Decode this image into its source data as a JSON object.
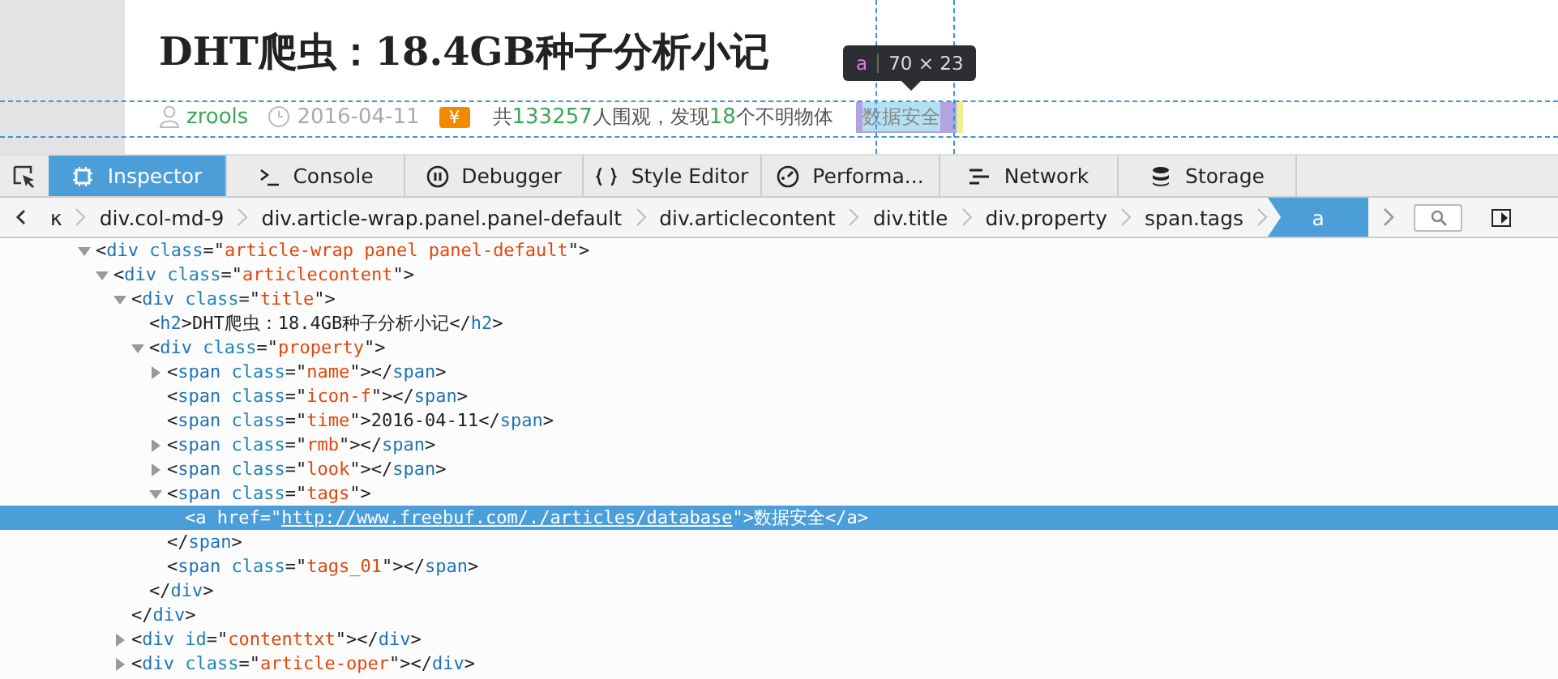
{
  "page": {
    "title": "DHT爬虫：18.4GB种子分析小记",
    "author": "zrools",
    "date": "2016-04-11",
    "price_badge": "¥",
    "views": [
      {
        "kind": "plain",
        "text": "共"
      },
      {
        "kind": "number",
        "text": "133257"
      },
      {
        "kind": "plain",
        "text": "人围观，发现"
      },
      {
        "kind": "number",
        "text": "18"
      },
      {
        "kind": "plain",
        "text": "个不明物体"
      }
    ],
    "tag": "数据安全"
  },
  "highlighter": {
    "tag": "a",
    "size": "70 × 23"
  },
  "tabs": [
    {
      "label": "Inspector",
      "selected": true
    },
    {
      "label": "Console",
      "selected": false
    },
    {
      "label": "Debugger",
      "selected": false
    },
    {
      "label": "Style Editor",
      "selected": false
    },
    {
      "label": "Performa...",
      "selected": false
    },
    {
      "label": "Network",
      "selected": false
    },
    {
      "label": "Storage",
      "selected": false
    }
  ],
  "breadcrumbs": [
    {
      "label": "κ",
      "selected": false
    },
    {
      "label": "div.col-md-9",
      "selected": false
    },
    {
      "label": "div.article-wrap.panel.panel-default",
      "selected": false
    },
    {
      "label": "div.articlecontent",
      "selected": false
    },
    {
      "label": "div.title",
      "selected": false
    },
    {
      "label": "div.property",
      "selected": false
    },
    {
      "label": "span.tags",
      "selected": false
    },
    {
      "label": "a",
      "selected": true
    }
  ],
  "tree": [
    {
      "markup": "<div class=\"article-wrap panel panel-default\">",
      "expanded": true,
      "selected": false,
      "children": [
        {
          "markup": "<div class=\"articlecontent\">",
          "expanded": true,
          "selected": false,
          "children": [
            {
              "markup": "<div class=\"title\">",
              "expanded": true,
              "selected": false,
              "closing": "</div>",
              "children": [
                {
                  "markup": "<h2>DHT爬虫：18.4GB种子分析小记</h2>",
                  "selected": false
                },
                {
                  "markup": "<div class=\"property\">",
                  "expanded": true,
                  "selected": false,
                  "closing": "</div>",
                  "children": [
                    {
                      "markup": "<span class=\"name\"></span>",
                      "expanded": false,
                      "selected": false
                    },
                    {
                      "markup": "<span class=\"icon-f\"></span>",
                      "selected": false
                    },
                    {
                      "markup": "<span class=\"time\">2016-04-11</span>",
                      "selected": false
                    },
                    {
                      "markup": "<span class=\"rmb\"></span>",
                      "expanded": false,
                      "selected": false
                    },
                    {
                      "markup": "<span class=\"look\"></span>",
                      "expanded": false,
                      "selected": false
                    },
                    {
                      "markup": "<span class=\"tags\">",
                      "expanded": true,
                      "selected": false,
                      "closing": "</span>",
                      "children": [
                        {
                          "markup": "<a href=\"http://www.freebuf.com/./articles/database\">数据安全</a>",
                          "link": true,
                          "selected": true
                        }
                      ]
                    },
                    {
                      "markup": "<span class=\"tags_01\"></span>",
                      "selected": false
                    }
                  ]
                }
              ]
            },
            {
              "markup": "<div id=\"contenttxt\"></div>",
              "expanded": false,
              "selected": false
            },
            {
              "markup": "<div class=\"article-oper\"></div>",
              "expanded": false,
              "selected": false
            }
          ]
        }
      ]
    }
  ]
}
